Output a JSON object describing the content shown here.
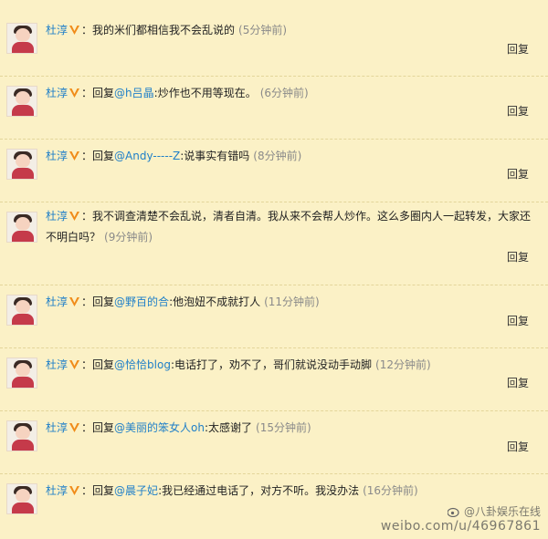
{
  "comments": [
    {
      "name": "杜淳",
      "prefix": "",
      "mention": "",
      "text": "我的米们都相信我不会乱说的",
      "time": "(5分钟前)",
      "reply": "回复"
    },
    {
      "name": "杜淳",
      "prefix": "回复",
      "mention": "@h吕晶",
      "text": ":炒作也不用等现在。",
      "time": "(6分钟前)",
      "reply": "回复"
    },
    {
      "name": "杜淳",
      "prefix": "回复",
      "mention": "@Andy-----Z",
      "text": ":说事实有错吗",
      "time": "(8分钟前)",
      "reply": "回复"
    },
    {
      "name": "杜淳",
      "prefix": "",
      "mention": "",
      "text": "我不调查清楚不会乱说，清者自清。我从来不会帮人炒作。这么多圈内人一起转发，大家还不明白吗？",
      "time": "(9分钟前)",
      "reply": "回复"
    },
    {
      "name": "杜淳",
      "prefix": "回复",
      "mention": "@野百的合",
      "text": ":他泡妞不成就打人",
      "time": "(11分钟前)",
      "reply": "回复"
    },
    {
      "name": "杜淳",
      "prefix": "回复",
      "mention": "@恰恰blog",
      "text": ":电话打了，劝不了，哥们就说没动手动脚",
      "time": "(12分钟前)",
      "reply": "回复"
    },
    {
      "name": "杜淳",
      "prefix": "回复",
      "mention": "@美丽的笨女人oh",
      "text": ":太感谢了",
      "time": "(15分钟前)",
      "reply": "回复"
    },
    {
      "name": "杜淳",
      "prefix": "回复",
      "mention": "@晨子妃",
      "text": ":我已经通过电话了，对方不听。我没办法",
      "time": "(16分钟前)",
      "reply": ""
    }
  ],
  "watermark": {
    "line1": "@八卦娱乐在线",
    "line2": "weibo.com/u/46967861"
  },
  "icons": {
    "verified": "verified-v-icon",
    "avatar": "avatar",
    "weibo": "weibo-logo-icon"
  },
  "colors": {
    "background": "#fbf1c6",
    "link": "#1f7fc8",
    "time": "#8a8a8a"
  }
}
